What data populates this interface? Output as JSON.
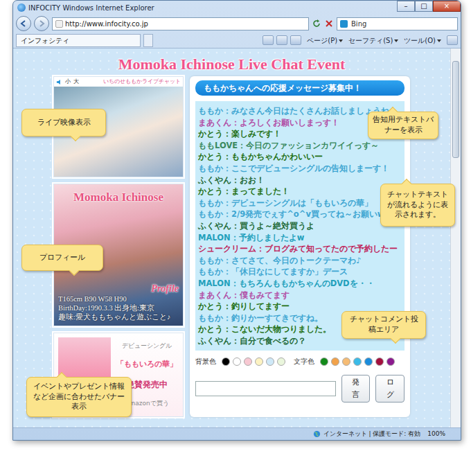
{
  "window": {
    "title": "INFOCITY  Windows Internet Explorer",
    "controls": [
      "–",
      "□",
      "×"
    ]
  },
  "address": {
    "url": "http://www.infocity.co.jp"
  },
  "search": {
    "placeholder": "Bing"
  },
  "tab": {
    "label": "インフォシティ"
  },
  "toolbar": [
    "ページ(P)",
    "セーフティ(S)",
    "ツール(O)"
  ],
  "page": {
    "title": "Momoka Ichinose Live Chat Event"
  },
  "video": {
    "sizes": [
      "小",
      "大"
    ],
    "label": "いちのせももかライブチャット"
  },
  "profile": {
    "name": "Momoka Ichinose",
    "badge": "Profile",
    "lines": [
      "T165cm B90 W58 H90",
      "BirthDay:1990.3.3 出身地:東京",
      "趣味:愛犬ももちゃんと遊ぶこと♪"
    ]
  },
  "banner": {
    "kicker": "デビューシングル",
    "song": "「ももいろの華」",
    "hot": "絶賛発売中",
    "buy": "Amazonで買う"
  },
  "chat": {
    "header": "ももかちゃんへの応援メッセージ募集中！",
    "messages": [
      {
        "text": "ももか：みなさん今日はたくさんお話しましょうね♪",
        "color": "#3ea6d2"
      },
      {
        "text": "まあくん：よろしくお願いしまっす！",
        "color": "#b24fa6"
      },
      {
        "text": "かとう：楽しみです！",
        "color": "#237014"
      },
      {
        "text": "ももLOVE：今日のファッションカワイイっす～",
        "color": "#3a8a60"
      },
      {
        "text": "かとう：ももかちゃんかわいいー",
        "color": "#237014"
      },
      {
        "text": "ももか：ここでデビューシングルの告知しまーす！",
        "color": "#3ea6d2"
      },
      {
        "text": "ふくやん：おお！",
        "color": "#1f6a38"
      },
      {
        "text": "かとう：まってました！",
        "color": "#237014"
      },
      {
        "text": "ももか：デビューシングルは「ももいろの華」",
        "color": "#3ea6d2"
      },
      {
        "text": "ももか：2/9発売でぇす^o^v買ってね～お願いw",
        "color": "#3ea6d2"
      },
      {
        "text": "ふくやん：買うよ～絶対買うよ",
        "color": "#1f6a38"
      },
      {
        "text": "MALON：予約しましたよw",
        "color": "#22a0bc"
      },
      {
        "text": "シュークリーム：ブログみて知ってたので予約したー",
        "color": "#c0245a"
      },
      {
        "text": "ももか：さてさて、今日のトークテーマわ♪",
        "color": "#3ea6d2"
      },
      {
        "text": "ももか：「休日なにしてますか」デース",
        "color": "#3ea6d2"
      },
      {
        "text": "MALON：もちろんももかちゃんのDVDを・・",
        "color": "#22a0bc"
      },
      {
        "text": "まあくん：僕もみてます",
        "color": "#b24fa6"
      },
      {
        "text": "かとう：釣りしてますー",
        "color": "#237014"
      },
      {
        "text": "ももか：釣りかーすてきですね。",
        "color": "#3ea6d2"
      },
      {
        "text": "かとう：こないだ大物つりました。",
        "color": "#237014"
      },
      {
        "text": "ふくやん：自分で食べるの？",
        "color": "#1f6a38"
      }
    ],
    "bg_label": "背景色",
    "bg_colors": [
      {
        "color": "#000000"
      },
      {
        "color": "#ffffff"
      },
      {
        "color": "#f8c8d2"
      },
      {
        "color": "#fdf3c2"
      },
      {
        "color": "#cfe9f8"
      },
      {
        "color": "#eaf6dc"
      }
    ],
    "text_label": "文字色",
    "text_colors": [
      {
        "color": "#138a1a"
      },
      {
        "color": "#f2a24a"
      },
      {
        "color": "#f6bc74"
      },
      {
        "color": "#3bbbe8"
      },
      {
        "color": "#1a8cdc"
      },
      {
        "color": "#a3103e"
      },
      {
        "color": "#8c1a8e"
      }
    ],
    "buttons": [
      "発言",
      "ログ"
    ]
  },
  "status": {
    "zone": "インターネット | 保護モード: 有効",
    "zoom": "100%"
  },
  "notes": [
    {
      "text": "ライブ映像表示"
    },
    {
      "text": "告知用テキストバナーを表示"
    },
    {
      "text": "チャットテキストが流れるように表示されます。"
    },
    {
      "text": "プロフィール"
    },
    {
      "text": "チャットコメント投稿エリア"
    },
    {
      "text": "イベントやプレゼント情報など企画に合わせたバナー表示"
    }
  ]
}
